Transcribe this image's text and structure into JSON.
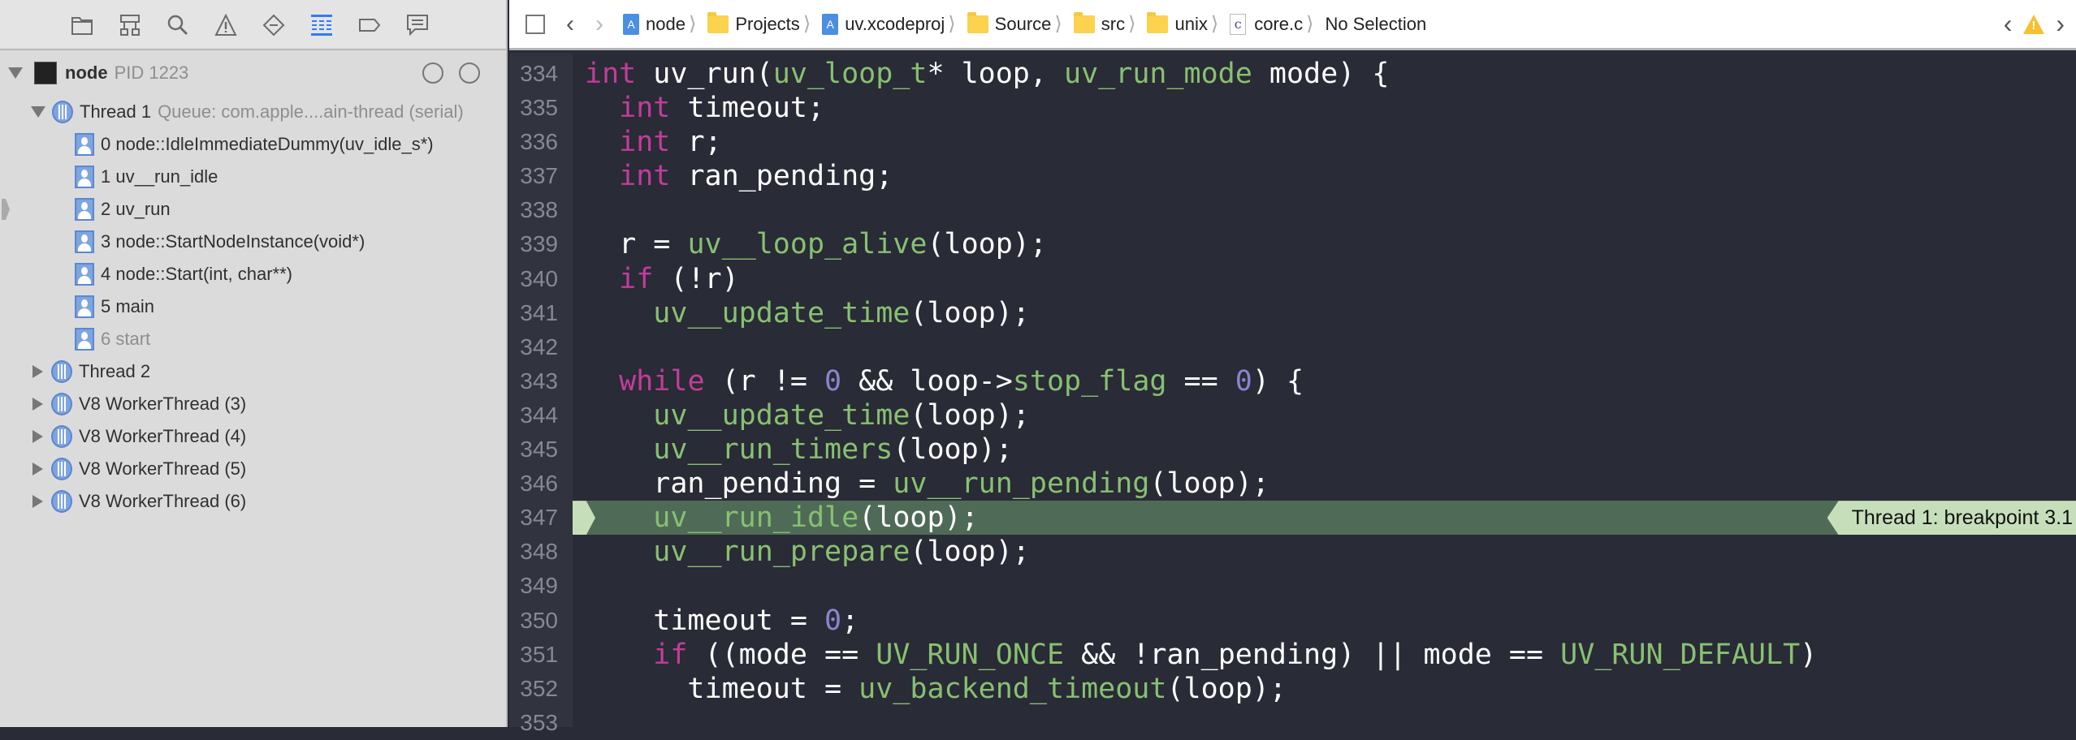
{
  "navigator": {
    "icons": [
      "folder-icon",
      "hierarchy-icon",
      "search-icon",
      "warning-icon",
      "breakpoint-icon",
      "debug-list-icon",
      "tag-icon",
      "message-icon"
    ],
    "active": "debug-list-icon"
  },
  "process": {
    "name": "node",
    "pid": "PID 1223"
  },
  "threads": [
    {
      "label": "Thread 1",
      "detail": "Queue: com.apple....ain-thread (serial)",
      "expanded": true,
      "frames": [
        {
          "label": "0 node::IdleImmediateDummy(uv_idle_s*)"
        },
        {
          "label": "1 uv__run_idle"
        },
        {
          "label": "2 uv_run",
          "current": true
        },
        {
          "label": "3 node::StartNodeInstance(void*)"
        },
        {
          "label": "4 node::Start(int, char**)"
        },
        {
          "label": "5 main"
        },
        {
          "label": "6 start",
          "dim": true
        }
      ]
    },
    {
      "label": "Thread 2",
      "detail": "",
      "expanded": false
    },
    {
      "label": "V8 WorkerThread (3)",
      "detail": "",
      "expanded": false
    },
    {
      "label": "V8 WorkerThread (4)",
      "detail": "",
      "expanded": false
    },
    {
      "label": "V8 WorkerThread (5)",
      "detail": "",
      "expanded": false
    },
    {
      "label": "V8 WorkerThread (6)",
      "detail": "",
      "expanded": false
    }
  ],
  "breadcrumb": [
    {
      "label": "node",
      "type": "project"
    },
    {
      "label": "Projects",
      "type": "folder"
    },
    {
      "label": "uv.xcodeproj",
      "type": "project"
    },
    {
      "label": "Source",
      "type": "folder"
    },
    {
      "label": "src",
      "type": "folder"
    },
    {
      "label": "unix",
      "type": "folder"
    },
    {
      "label": "core.c",
      "type": "c-file"
    },
    {
      "label": "No Selection",
      "type": "text"
    }
  ],
  "colors": {
    "keyword": "#c23d9a",
    "function": "#88c071",
    "number": "#8c84d0",
    "highlight": "#4f6b57",
    "breakpoint_label": "#c6dfba",
    "warning": "#f7c030"
  },
  "breakpoint": {
    "line": 347,
    "label": "Thread 1: breakpoint 3.1"
  },
  "code": {
    "lines": [
      {
        "n": "334",
        "t": [
          [
            "k",
            "int"
          ],
          [
            "p",
            " uv_run("
          ],
          [
            "f",
            "uv_loop_t"
          ],
          [
            "p",
            "* loop, "
          ],
          [
            "f",
            "uv_run_mode"
          ],
          [
            "p",
            " mode) {"
          ]
        ]
      },
      {
        "n": "335",
        "t": [
          [
            "p",
            "  "
          ],
          [
            "k",
            "int"
          ],
          [
            "p",
            " timeout;"
          ]
        ]
      },
      {
        "n": "336",
        "t": [
          [
            "p",
            "  "
          ],
          [
            "k",
            "int"
          ],
          [
            "p",
            " r;"
          ]
        ]
      },
      {
        "n": "337",
        "t": [
          [
            "p",
            "  "
          ],
          [
            "k",
            "int"
          ],
          [
            "p",
            " ran_pending;"
          ]
        ]
      },
      {
        "n": "338",
        "t": []
      },
      {
        "n": "339",
        "t": [
          [
            "p",
            "  r = "
          ],
          [
            "f",
            "uv__loop_alive"
          ],
          [
            "p",
            "(loop);"
          ]
        ]
      },
      {
        "n": "340",
        "t": [
          [
            "p",
            "  "
          ],
          [
            "k",
            "if"
          ],
          [
            "p",
            " (!r)"
          ]
        ]
      },
      {
        "n": "341",
        "t": [
          [
            "p",
            "    "
          ],
          [
            "f",
            "uv__update_time"
          ],
          [
            "p",
            "(loop);"
          ]
        ]
      },
      {
        "n": "342",
        "t": []
      },
      {
        "n": "343",
        "t": [
          [
            "p",
            "  "
          ],
          [
            "k",
            "while"
          ],
          [
            "p",
            " (r != "
          ],
          [
            "n",
            "0"
          ],
          [
            "p",
            " && loop->"
          ],
          [
            "f",
            "stop_flag"
          ],
          [
            "p",
            " == "
          ],
          [
            "n",
            "0"
          ],
          [
            "p",
            ") {"
          ]
        ]
      },
      {
        "n": "344",
        "t": [
          [
            "p",
            "    "
          ],
          [
            "f",
            "uv__update_time"
          ],
          [
            "p",
            "(loop);"
          ]
        ]
      },
      {
        "n": "345",
        "t": [
          [
            "p",
            "    "
          ],
          [
            "f",
            "uv__run_timers"
          ],
          [
            "p",
            "(loop);"
          ]
        ]
      },
      {
        "n": "346",
        "t": [
          [
            "p",
            "    ran_pending = "
          ],
          [
            "f",
            "uv__run_pending"
          ],
          [
            "p",
            "(loop);"
          ]
        ]
      },
      {
        "n": "347",
        "t": [
          [
            "p",
            "    "
          ],
          [
            "f",
            "uv__run_idle"
          ],
          [
            "p",
            "(loop);"
          ]
        ]
      },
      {
        "n": "348",
        "t": [
          [
            "p",
            "    "
          ],
          [
            "f",
            "uv__run_prepare"
          ],
          [
            "p",
            "(loop);"
          ]
        ]
      },
      {
        "n": "349",
        "t": []
      },
      {
        "n": "350",
        "t": [
          [
            "p",
            "    timeout = "
          ],
          [
            "n",
            "0"
          ],
          [
            "p",
            ";"
          ]
        ]
      },
      {
        "n": "351",
        "t": [
          [
            "p",
            "    "
          ],
          [
            "k",
            "if"
          ],
          [
            "p",
            " ((mode == "
          ],
          [
            "f",
            "UV_RUN_ONCE"
          ],
          [
            "p",
            " && !ran_pending) || mode == "
          ],
          [
            "f",
            "UV_RUN_DEFAULT"
          ],
          [
            "p",
            ")"
          ]
        ]
      },
      {
        "n": "352",
        "t": [
          [
            "p",
            "      timeout = "
          ],
          [
            "f",
            "uv_backend_timeout"
          ],
          [
            "p",
            "(loop);"
          ]
        ]
      },
      {
        "n": "353",
        "t": []
      }
    ]
  }
}
